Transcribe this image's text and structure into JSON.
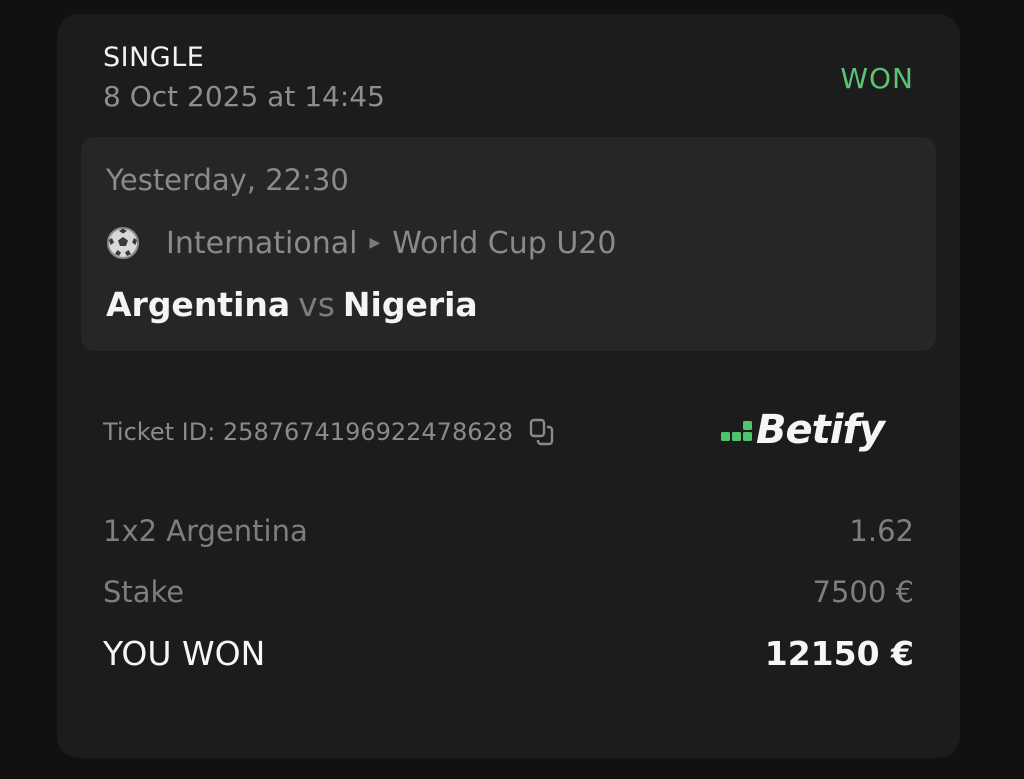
{
  "ticket": {
    "bet_type": "SINGLE",
    "placed_at": "8 Oct 2025 at 14:45",
    "status": "WON",
    "status_color": "#5cc276"
  },
  "event": {
    "time": "Yesterday, 22:30",
    "sport_icon": "soccer-ball-icon",
    "category": "International",
    "separator_icon": "caret-right-icon",
    "league": "World Cup U20",
    "home": "Argentina",
    "vs": "vs",
    "away": "Nigeria"
  },
  "ticket_id": {
    "label": "Ticket ID: 2587674196922478628",
    "copy_icon": "copy-icon"
  },
  "brand": {
    "name": "Betify",
    "accent": "#4fc46b"
  },
  "lines": {
    "selection_label": "1x2 Argentina",
    "selection_value": "1.62",
    "stake_label": "Stake",
    "stake_value": "7500 €",
    "won_label": "YOU WON",
    "won_value": "12150 €"
  }
}
